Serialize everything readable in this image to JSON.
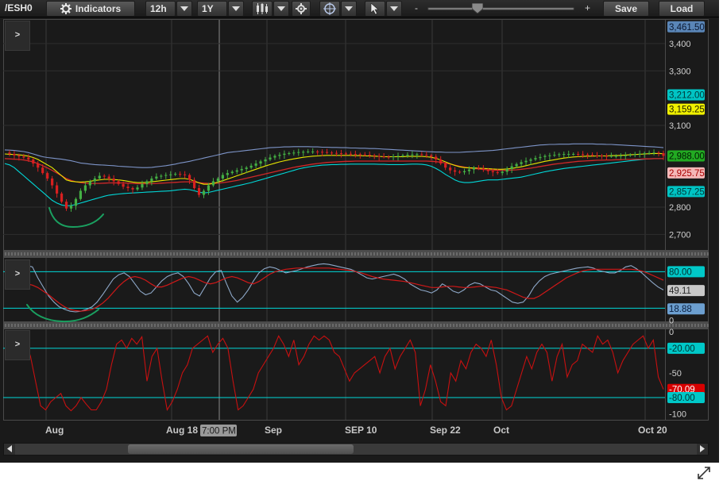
{
  "toolbar": {
    "symbol": "/ESH0",
    "indicators_label": "Indicators",
    "interval_value": "12h",
    "period_value": "1Y",
    "zoom_minus": "-",
    "zoom_plus": "+",
    "zoom_level": 0.37,
    "save_label": "Save",
    "load_label": "Load",
    "icons": [
      "indicators-gear-icon",
      "candlestick-chart-icon",
      "settings-gear-icon",
      "crosshair-icon",
      "cursor-arrow-icon"
    ]
  },
  "panels": {
    "expand_label": ">"
  },
  "price_panel": {
    "axis_ticks": [
      "3,400",
      "3,300",
      "3,100",
      "2,800",
      "2,700"
    ],
    "ymin": 2640,
    "ymax": 3490,
    "badges": [
      {
        "label": "3,461.50",
        "value": 3461.5,
        "bg": "#5a86b8",
        "fg": "#0b1830"
      },
      {
        "label": "3,212.00",
        "value": 3212.0,
        "bg": "#00c4c4",
        "fg": "#003838"
      },
      {
        "label": "3,159.25",
        "value": 3159.25,
        "bg": "#f0f000",
        "fg": "#1a1a00"
      },
      {
        "label": "2,988.00",
        "value": 2988.0,
        "bg": "#22aa22",
        "fg": "#001800"
      },
      {
        "label": "2,925.75",
        "value": 2925.75,
        "bg": "#f4b8b8",
        "fg": "#a80000"
      },
      {
        "label": "2,857.25",
        "value": 2857.25,
        "bg": "#00c4c4",
        "fg": "#003838"
      }
    ]
  },
  "stoch_panel": {
    "axis_ticks": [
      "0"
    ],
    "ymin": -3,
    "ymax": 104,
    "levels": [
      80,
      20
    ],
    "badges": [
      {
        "label": "80.00",
        "value": 80,
        "bg": "#00c8c8",
        "fg": "#003030"
      },
      {
        "label": "49.11",
        "value": 49.11,
        "bg": "#c8c8c8",
        "fg": "#2a2a2a"
      },
      {
        "label": "18.88",
        "value": 18.88,
        "bg": "#6c9fd0",
        "fg": "#0b2040"
      }
    ]
  },
  "williams_panel": {
    "axis_ticks": [
      "0",
      "-50",
      "-100"
    ],
    "ymin": -108,
    "ymax": 4,
    "levels": [
      -20,
      -80
    ],
    "badges": [
      {
        "label": "-20.00",
        "value": -20,
        "bg": "#00c8c8",
        "fg": "#003030"
      },
      {
        "label": "-70.09",
        "value": -70.09,
        "bg": "#d80000",
        "fg": "#ffffff"
      },
      {
        "label": "-80.00",
        "value": -80,
        "bg": "#00c8c8",
        "fg": "#003030"
      }
    ]
  },
  "time_axis": {
    "labels": [
      "Aug",
      "Aug 18",
      "Sep",
      "SEP 10",
      "Sep 22",
      "Oct",
      "Oct 20"
    ],
    "cursor_time": "7:00 PM"
  },
  "colors": {
    "background": "#1a1a1a",
    "grid": "#3a3a3a",
    "candle_up": "#44b044",
    "candle_down": "#d82020",
    "bollinger": "#7d94c8",
    "keltner": "#00d8d8",
    "sma_yellow": "#e8e800",
    "sma_red": "#d02828",
    "stoch_k": "#8ea8c8",
    "stoch_d": "#d01818",
    "williams": "#c81010",
    "annotation": "#1aa060"
  },
  "chart_data": {
    "type": "line",
    "price": {
      "ohlc_x_domain": [
        0,
        139
      ],
      "closes": [
        3000,
        2995,
        2990,
        2986,
        2982,
        2975,
        2960,
        2945,
        2925,
        2905,
        2880,
        2850,
        2820,
        2795,
        2805,
        2830,
        2860,
        2880,
        2895,
        2905,
        2915,
        2912,
        2905,
        2895,
        2885,
        2875,
        2870,
        2865,
        2872,
        2885,
        2895,
        2905,
        2912,
        2915,
        2918,
        2920,
        2922,
        2920,
        2918,
        2900,
        2870,
        2845,
        2860,
        2880,
        2895,
        2905,
        2918,
        2925,
        2930,
        2935,
        2940,
        2945,
        2952,
        2960,
        2968,
        2975,
        2982,
        2988,
        2992,
        2996,
        2998,
        3000,
        3002,
        3003,
        3004,
        3004,
        3003,
        3002,
        3000,
        2999,
        2998,
        2997,
        2996,
        2995,
        2994,
        2993,
        2992,
        2990,
        2988,
        2986,
        2985,
        2984,
        2986,
        2988,
        2990,
        2992,
        2993,
        2994,
        2992,
        2990,
        2985,
        2975,
        2960,
        2945,
        2935,
        2930,
        2928,
        2932,
        2938,
        2945,
        2942,
        2938,
        2932,
        2928,
        2925,
        2930,
        2940,
        2950,
        2958,
        2965,
        2970,
        2975,
        2980,
        2984,
        2988,
        2990,
        2992,
        2994,
        2995,
        2995,
        2995,
        2994,
        2993,
        2992,
        2990,
        2989,
        2988,
        2987,
        2988,
        2988,
        2989,
        2990,
        2992,
        2994,
        2996,
        2998,
        2999,
        3000,
        2998,
        2988
      ],
      "bollinger_upper": [
        3010,
        3009,
        3008,
        3006,
        3004,
        3000,
        2995,
        2990,
        2985,
        2982,
        2980,
        2978,
        2976,
        2973,
        2970,
        2966,
        2962,
        2960,
        2958,
        2956,
        2955,
        2954,
        2953,
        2952,
        2950,
        2949,
        2948,
        2947,
        2946,
        2945,
        2945,
        2946,
        2948,
        2950,
        2952,
        2955,
        2958,
        2962,
        2965,
        2968,
        2972,
        2976,
        2980,
        2984,
        2988,
        2992,
        2996,
        3000,
        3002,
        3004,
        3006,
        3008,
        3010,
        3012,
        3014,
        3016,
        3018,
        3019,
        3020,
        3021,
        3021,
        3022,
        3022,
        3022,
        3022,
        3021,
        3021,
        3020,
        3020,
        3019,
        3019,
        3018,
        3018,
        3017,
        3017,
        3016,
        3016,
        3015,
        3015,
        3014,
        3013,
        3012,
        3011,
        3010,
        3009,
        3008,
        3007,
        3006,
        3005,
        3004,
        3003,
        3002,
        3002,
        3001,
        3001,
        3001,
        3001,
        3002,
        3003,
        3004,
        3005,
        3006,
        3007,
        3008,
        3010,
        3012,
        3014,
        3016,
        3018,
        3020,
        3022,
        3024,
        3026,
        3028,
        3029,
        3030,
        3030,
        3031,
        3031,
        3031,
        3032,
        3032,
        3032,
        3032,
        3032,
        3031,
        3031,
        3030,
        3030,
        3029,
        3028,
        3027,
        3026,
        3025,
        3024,
        3023,
        3022,
        3021,
        3020,
        3018
      ],
      "keltner_lower": [
        2960,
        2955,
        2945,
        2930,
        2915,
        2900,
        2885,
        2870,
        2855,
        2840,
        2825,
        2815,
        2808,
        2805,
        2806,
        2810,
        2815,
        2820,
        2825,
        2830,
        2835,
        2840,
        2844,
        2846,
        2848,
        2850,
        2851,
        2852,
        2853,
        2854,
        2855,
        2856,
        2857,
        2858,
        2859,
        2860,
        2862,
        2864,
        2866,
        2864,
        2860,
        2855,
        2852,
        2854,
        2858,
        2862,
        2866,
        2870,
        2874,
        2878,
        2882,
        2886,
        2890,
        2895,
        2900,
        2905,
        2910,
        2915,
        2920,
        2925,
        2930,
        2935,
        2940,
        2944,
        2947,
        2950,
        2952,
        2954,
        2955,
        2956,
        2956,
        2957,
        2957,
        2958,
        2958,
        2958,
        2958,
        2958,
        2958,
        2957,
        2957,
        2956,
        2956,
        2956,
        2956,
        2957,
        2958,
        2958,
        2957,
        2955,
        2950,
        2942,
        2932,
        2920,
        2910,
        2900,
        2893,
        2890,
        2890,
        2892,
        2895,
        2898,
        2900,
        2900,
        2900,
        2902,
        2904,
        2906,
        2908,
        2910,
        2914,
        2918,
        2922,
        2926,
        2930,
        2933,
        2936,
        2939,
        2942,
        2944,
        2946,
        2948,
        2950,
        2952,
        2954,
        2956,
        2958,
        2960,
        2962,
        2964,
        2966,
        2968,
        2970,
        2972,
        2974,
        2976,
        2977,
        2978,
        2978,
        2978
      ],
      "sma_yellow": [
        2995,
        2994,
        2993,
        2992,
        2990,
        2987,
        2982,
        2975,
        2965,
        2955,
        2945,
        2930,
        2915,
        2900,
        2895,
        2893,
        2892,
        2893,
        2895,
        2898,
        2900,
        2902,
        2902,
        2901,
        2900,
        2898,
        2895,
        2892,
        2890,
        2890,
        2891,
        2893,
        2895,
        2897,
        2899,
        2901,
        2903,
        2905,
        2905,
        2902,
        2896,
        2889,
        2884,
        2884,
        2887,
        2892,
        2897,
        2903,
        2909,
        2915,
        2921,
        2927,
        2933,
        2939,
        2945,
        2951,
        2956,
        2961,
        2966,
        2970,
        2974,
        2977,
        2980,
        2983,
        2985,
        2987,
        2988,
        2989,
        2990,
        2990,
        2990,
        2990,
        2990,
        2990,
        2989,
        2989,
        2988,
        2988,
        2987,
        2986,
        2985,
        2985,
        2985,
        2985,
        2985,
        2986,
        2986,
        2986,
        2986,
        2985,
        2983,
        2979,
        2973,
        2966,
        2959,
        2953,
        2948,
        2945,
        2944,
        2944,
        2943,
        2942,
        2941,
        2940,
        2939,
        2939,
        2940,
        2942,
        2945,
        2948,
        2952,
        2956,
        2960,
        2964,
        2968,
        2971,
        2974,
        2977,
        2980,
        2982,
        2984,
        2985,
        2986,
        2987,
        2987,
        2988,
        2988,
        2988,
        2989,
        2989,
        2990,
        2991,
        2992,
        2993,
        2994,
        2995,
        2996,
        2997,
        2997,
        2996
      ],
      "sma_red": [
        2978,
        2977,
        2976,
        2975,
        2973,
        2970,
        2966,
        2960,
        2952,
        2944,
        2935,
        2925,
        2915,
        2905,
        2898,
        2893,
        2890,
        2888,
        2887,
        2887,
        2887,
        2888,
        2889,
        2889,
        2889,
        2889,
        2888,
        2887,
        2886,
        2886,
        2886,
        2886,
        2887,
        2888,
        2889,
        2890,
        2891,
        2892,
        2893,
        2893,
        2892,
        2890,
        2888,
        2887,
        2887,
        2888,
        2890,
        2892,
        2895,
        2898,
        2902,
        2906,
        2910,
        2914,
        2918,
        2922,
        2926,
        2930,
        2934,
        2938,
        2942,
        2946,
        2949,
        2952,
        2955,
        2958,
        2960,
        2962,
        2964,
        2965,
        2966,
        2967,
        2968,
        2968,
        2969,
        2969,
        2969,
        2969,
        2969,
        2969,
        2969,
        2969,
        2969,
        2969,
        2969,
        2969,
        2969,
        2969,
        2969,
        2969,
        2968,
        2967,
        2965,
        2962,
        2958,
        2954,
        2950,
        2947,
        2944,
        2942,
        2940,
        2938,
        2937,
        2936,
        2935,
        2935,
        2935,
        2936,
        2937,
        2939,
        2941,
        2943,
        2946,
        2949,
        2952,
        2955,
        2958,
        2960,
        2962,
        2964,
        2966,
        2968,
        2969,
        2970,
        2971,
        2972,
        2972,
        2973,
        2973,
        2974,
        2974,
        2975,
        2975,
        2976,
        2976,
        2977,
        2977,
        2978,
        2978,
        2978
      ]
    },
    "stochastic": {
      "k": [
        90,
        88,
        70,
        55,
        40,
        30,
        22,
        18,
        15,
        14,
        15,
        18,
        22,
        30,
        42,
        55,
        68,
        75,
        78,
        72,
        60,
        48,
        42,
        45,
        55,
        65,
        72,
        76,
        78,
        72,
        60,
        45,
        40,
        55,
        70,
        80,
        82,
        60,
        40,
        30,
        38,
        50,
        65,
        78,
        85,
        88,
        86,
        82,
        78,
        80,
        82,
        85,
        88,
        90,
        92,
        93,
        92,
        90,
        88,
        86,
        84,
        80,
        75,
        70,
        68,
        70,
        72,
        74,
        76,
        73,
        68,
        60,
        55,
        50,
        48,
        45,
        50,
        60,
        55,
        48,
        45,
        50,
        58,
        62,
        60,
        55,
        50,
        48,
        42,
        36,
        30,
        28,
        30,
        40,
        55,
        65,
        72,
        76,
        78,
        80,
        82,
        84,
        86,
        87,
        88,
        86,
        82,
        80,
        78,
        78,
        82,
        88,
        90,
        85,
        78,
        70,
        62,
        55,
        50
      ],
      "d": [
        60,
        58,
        54,
        48,
        42,
        35,
        28,
        22,
        18,
        16,
        15,
        16,
        18,
        22,
        28,
        36,
        46,
        56,
        64,
        70,
        72,
        70,
        66,
        60,
        55,
        55,
        58,
        62,
        66,
        70,
        72,
        70,
        66,
        62,
        60,
        62,
        66,
        70,
        72,
        70,
        66,
        62,
        60,
        64,
        70,
        76,
        80,
        82,
        84,
        85,
        86,
        86,
        86,
        86,
        86,
        86,
        86,
        85,
        84,
        83,
        82,
        80,
        78,
        75,
        72,
        70,
        68,
        67,
        66,
        65,
        64,
        62,
        60,
        58,
        56,
        54,
        54,
        55,
        56,
        56,
        55,
        54,
        54,
        55,
        56,
        56,
        55,
        54,
        52,
        50,
        46,
        42,
        38,
        36,
        36,
        40,
        46,
        52,
        58,
        64,
        70,
        74,
        78,
        81,
        83,
        84,
        84,
        84,
        84,
        84,
        84,
        84,
        84,
        83,
        81,
        78,
        74,
        70,
        66
      ],
      "upper_level": 80,
      "lower_level": 20,
      "current_k": 49.11,
      "current_d": 18.88
    },
    "williams_r": {
      "values": [
        -10,
        -30,
        -60,
        -90,
        -95,
        -85,
        -80,
        -75,
        -90,
        -96,
        -90,
        -80,
        -88,
        -95,
        -95,
        -85,
        -70,
        -40,
        -15,
        -10,
        -20,
        -8,
        -15,
        -6,
        -60,
        -30,
        -20,
        -60,
        -95,
        -85,
        -70,
        -50,
        -40,
        -20,
        -15,
        -10,
        -5,
        -25,
        -15,
        -8,
        -20,
        -60,
        -95,
        -90,
        -80,
        -70,
        -50,
        -40,
        -30,
        -20,
        -5,
        -15,
        -30,
        -10,
        -40,
        -30,
        -15,
        -5,
        -10,
        -5,
        -10,
        -25,
        -30,
        -45,
        -60,
        -50,
        -45,
        -40,
        -35,
        -30,
        -50,
        -30,
        -20,
        -45,
        -30,
        -20,
        -10,
        -25,
        -90,
        -70,
        -40,
        -60,
        -85,
        -90,
        -50,
        -60,
        -35,
        -45,
        -25,
        -15,
        -20,
        -30,
        -10,
        -40,
        -80,
        -95,
        -90,
        -70,
        -50,
        -30,
        -45,
        -25,
        -15,
        -25,
        -60,
        -30,
        -15,
        -55,
        -40,
        -35,
        -15,
        -20,
        -25,
        -5,
        -15,
        -10,
        -25,
        -50,
        -35,
        -25,
        -15,
        -10,
        -5,
        -20,
        -10,
        -55,
        -70
      ],
      "upper_level": -20,
      "lower_level": -80,
      "current": -70.09
    }
  }
}
